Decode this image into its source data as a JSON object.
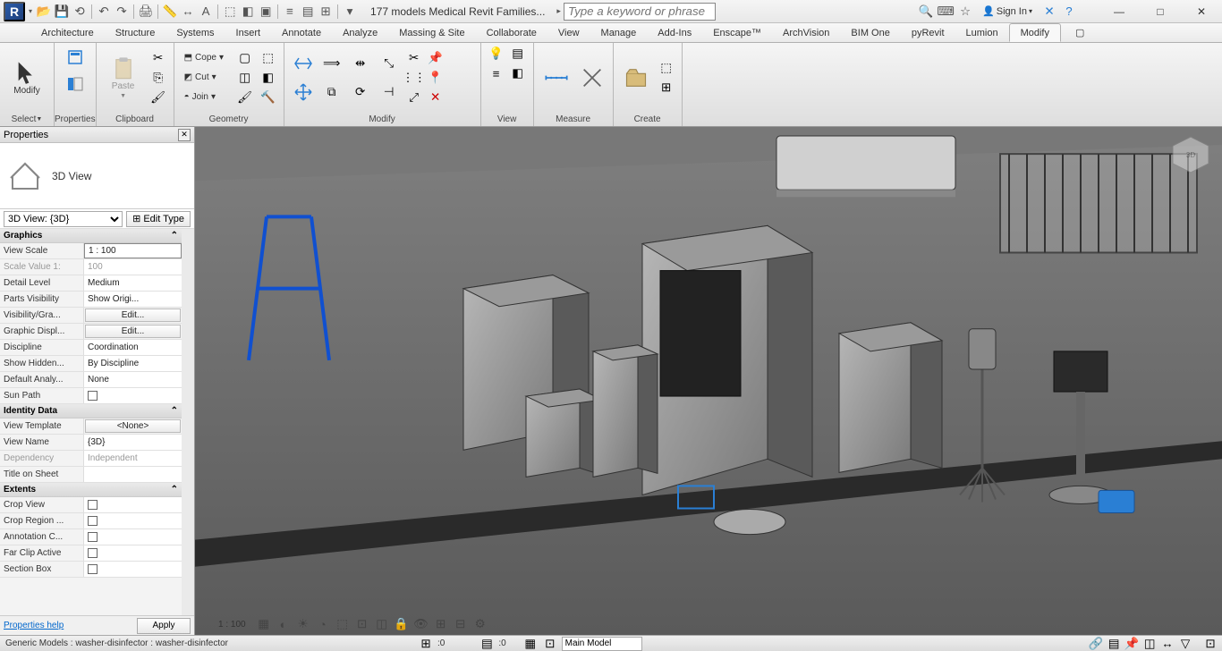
{
  "title": "177 models Medical Revit Families...",
  "search_placeholder": "Type a keyword or phrase",
  "signin_label": "Sign In",
  "menu_tabs": [
    "Architecture",
    "Structure",
    "Systems",
    "Insert",
    "Annotate",
    "Analyze",
    "Massing & Site",
    "Collaborate",
    "View",
    "Manage",
    "Add-Ins",
    "Enscape™",
    "ArchVision",
    "BIM One",
    "pyRevit",
    "Lumion",
    "Modify"
  ],
  "active_tab_index": 16,
  "ribbon": {
    "select": {
      "label": "Select",
      "modify": "Modify"
    },
    "properties": {
      "label": "Properties"
    },
    "clipboard": {
      "label": "Clipboard",
      "paste": "Paste",
      "cut": "Cut",
      "copy": "Copy"
    },
    "geometry": {
      "label": "Geometry",
      "cope": "Cope",
      "join": "Join"
    },
    "modify": {
      "label": "Modify"
    },
    "view": {
      "label": "View"
    },
    "measure": {
      "label": "Measure"
    },
    "create": {
      "label": "Create"
    }
  },
  "properties_panel": {
    "title": "Properties",
    "type_label": "3D View",
    "dropdown": "3D View: {3D}",
    "edit_type": "Edit Type",
    "sections": {
      "graphics": "Graphics",
      "identity": "Identity Data",
      "extents": "Extents"
    },
    "props": {
      "view_scale": {
        "label": "View Scale",
        "value": "1 : 100"
      },
      "scale_value": {
        "label": "Scale Value    1:",
        "value": "100"
      },
      "detail_level": {
        "label": "Detail Level",
        "value": "Medium"
      },
      "parts_vis": {
        "label": "Parts Visibility",
        "value": "Show Origi..."
      },
      "vis_graphics": {
        "label": "Visibility/Gra...",
        "value": "Edit..."
      },
      "graphic_disp": {
        "label": "Graphic Displ...",
        "value": "Edit..."
      },
      "discipline": {
        "label": "Discipline",
        "value": "Coordination"
      },
      "show_hidden": {
        "label": "Show Hidden...",
        "value": "By Discipline"
      },
      "default_analy": {
        "label": "Default Analy...",
        "value": "None"
      },
      "sun_path": {
        "label": "Sun Path",
        "value": ""
      },
      "view_template": {
        "label": "View Template",
        "value": "<None>"
      },
      "view_name": {
        "label": "View Name",
        "value": "{3D}"
      },
      "dependency": {
        "label": "Dependency",
        "value": "Independent"
      },
      "title_sheet": {
        "label": "Title on Sheet",
        "value": ""
      },
      "crop_view": {
        "label": "Crop View",
        "value": ""
      },
      "crop_region": {
        "label": "Crop Region ...",
        "value": ""
      },
      "annotation_c": {
        "label": "Annotation C...",
        "value": ""
      },
      "far_clip": {
        "label": "Far Clip Active",
        "value": ""
      },
      "section_box": {
        "label": "Section Box",
        "value": ""
      }
    },
    "help": "Properties help",
    "apply": "Apply"
  },
  "view_controls": {
    "scale": "1 : 100"
  },
  "statusbar": {
    "selection": "Generic Models : washer-disinfector : washer-disinfector",
    "count": ":0",
    "main_model": "Main Model"
  }
}
